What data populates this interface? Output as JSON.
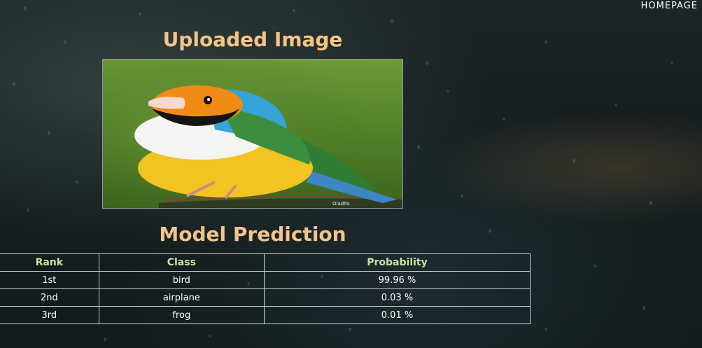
{
  "nav": {
    "homepage_label": "HOMEPAGE"
  },
  "upload": {
    "title": "Uploaded Image",
    "image_alt": "Colorful finch bird perched on a branch",
    "watermark": "Oladits"
  },
  "prediction": {
    "title": "Model Prediction",
    "columns": [
      "Rank",
      "Class",
      "Probability"
    ],
    "rows": [
      {
        "rank": "1st",
        "class": "bird",
        "probability": "99.96 %"
      },
      {
        "rank": "2nd",
        "class": "airplane",
        "probability": "0.03 %"
      },
      {
        "rank": "3rd",
        "class": "frog",
        "probability": "0.01 %"
      }
    ]
  },
  "colors": {
    "title": "#f4c48a",
    "header_text": "#c9e39c",
    "table_border": "#c9d2d2",
    "background": "#161e20"
  }
}
